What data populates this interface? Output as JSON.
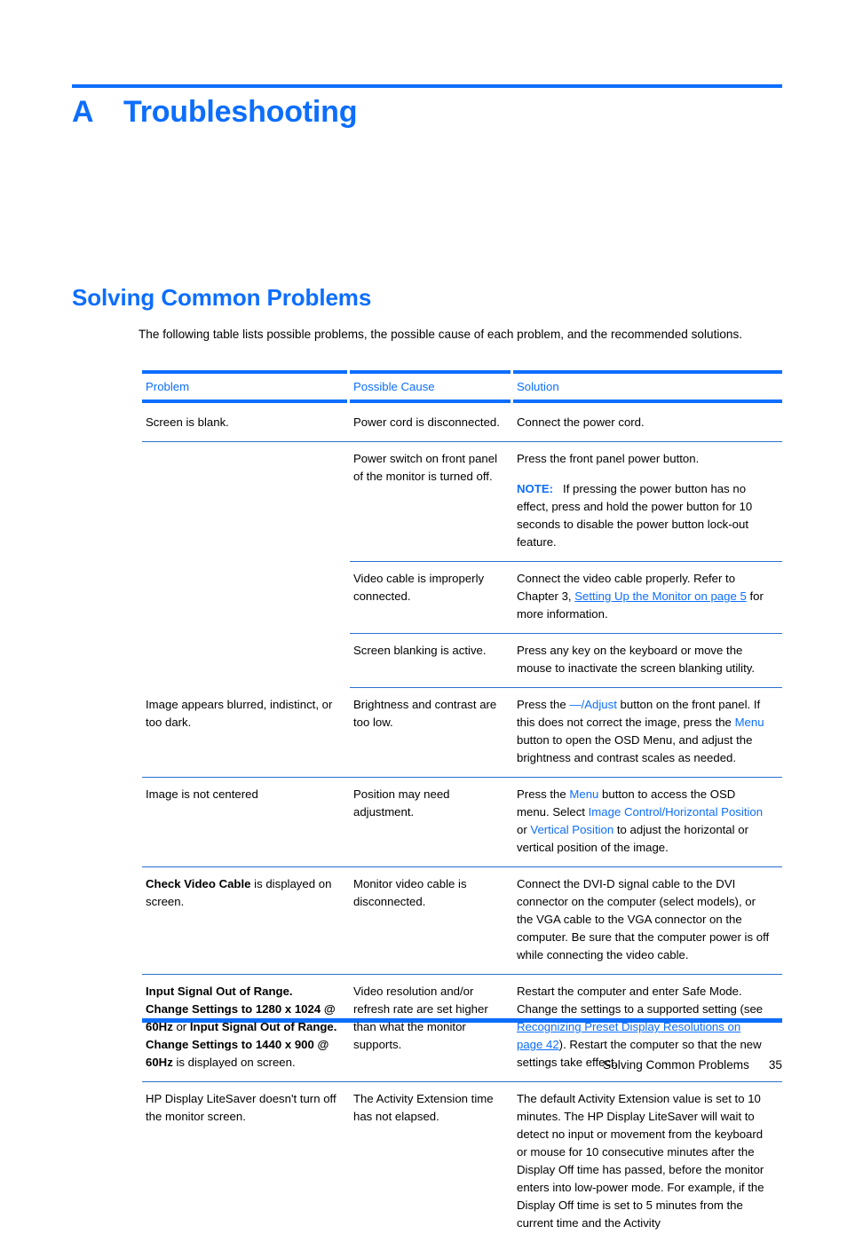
{
  "colors": {
    "accent_blue": "#0d6efd",
    "rule_blue": "#2a6fd0",
    "text": "#000000"
  },
  "chapter": {
    "letter": "A",
    "title": "Troubleshooting"
  },
  "section": {
    "heading": "Solving Common Problems",
    "intro": "The following table lists possible problems, the possible cause of each problem, and the recommended solutions."
  },
  "table": {
    "headers": {
      "problem": "Problem",
      "cause": "Possible Cause",
      "solution": "Solution"
    },
    "rows": [
      {
        "problem": "Screen is blank.",
        "cause": "Power cord is disconnected.",
        "solution": "Connect the power cord."
      },
      {
        "problem": "",
        "cause": "Power switch on front panel of the monitor is turned off.",
        "solution_p1": "Press the front panel power button.",
        "note_label": "NOTE:",
        "note_text": "If pressing the power button has no effect, press and hold the power button for 10 seconds to disable the power button lock-out feature."
      },
      {
        "problem": "",
        "cause": "Video cable is improperly connected.",
        "solution_a": "Connect the video cable properly. Refer to Chapter 3, ",
        "solution_link": "Setting Up the Monitor on page 5",
        "solution_b": " for more information."
      },
      {
        "problem": "",
        "cause": "Screen blanking is active.",
        "solution": "Press any key on the keyboard or move the mouse to inactivate the screen blanking utility."
      },
      {
        "problem": "Image appears blurred, indistinct, or too dark.",
        "cause": "Brightness and contrast are too low.",
        "solution_a": "Press the ",
        "solution_ui1": "—/Adjust",
        "solution_b": " button on the front panel. If this does not correct the image, press the ",
        "solution_ui2": "Menu",
        "solution_c": " button to open the OSD Menu, and adjust the brightness and contrast scales as needed."
      },
      {
        "problem": "Image is not centered",
        "cause": "Position may need adjustment.",
        "solution_a": "Press the ",
        "solution_ui1": "Menu",
        "solution_b": " button to access the OSD menu. Select ",
        "solution_ui2": "Image Control/Horizontal Position",
        "solution_c": " or ",
        "solution_ui3": "Vertical Position",
        "solution_d": " to adjust the horizontal or vertical position of the image."
      },
      {
        "problem_bold": "Check Video Cable",
        "problem_rest": " is displayed on screen.",
        "cause": "Monitor video cable is disconnected.",
        "solution": "Connect the DVI-D signal cable to the DVI connector on the computer (select models), or the VGA cable to the VGA connector on the computer. Be sure that the computer power is off while connecting the video cable."
      },
      {
        "problem_bold1": "Input Signal Out of Range. Change Settings to 1280 x 1024 @ 60Hz",
        "problem_mid": " or ",
        "problem_bold2": "Input Signal Out of Range. Change Settings to 1440 x 900 @ 60Hz",
        "problem_rest": " is displayed on screen.",
        "cause": "Video resolution and/or refresh rate are set higher than what the monitor supports.",
        "solution_a": "Restart the computer and enter Safe Mode. Change the settings to a supported setting (see ",
        "solution_link": "Recognizing Preset Display Resolutions on page 42",
        "solution_b": "). Restart the computer so that the new settings take effect."
      },
      {
        "problem": "HP Display LiteSaver doesn't turn off the monitor screen.",
        "cause": "The Activity Extension time has not elapsed.",
        "solution": "The default Activity Extension value is set to 10 minutes. The HP Display LiteSaver will wait to detect no input or movement from the keyboard or mouse for 10 consecutive minutes after the Display Off time has passed, before the monitor enters into low-power mode. For example, if the Display Off time is set to 5 minutes from the current time and the Activity"
      }
    ]
  },
  "footer": {
    "section_name": "Solving Common Problems",
    "page_number": "35"
  }
}
